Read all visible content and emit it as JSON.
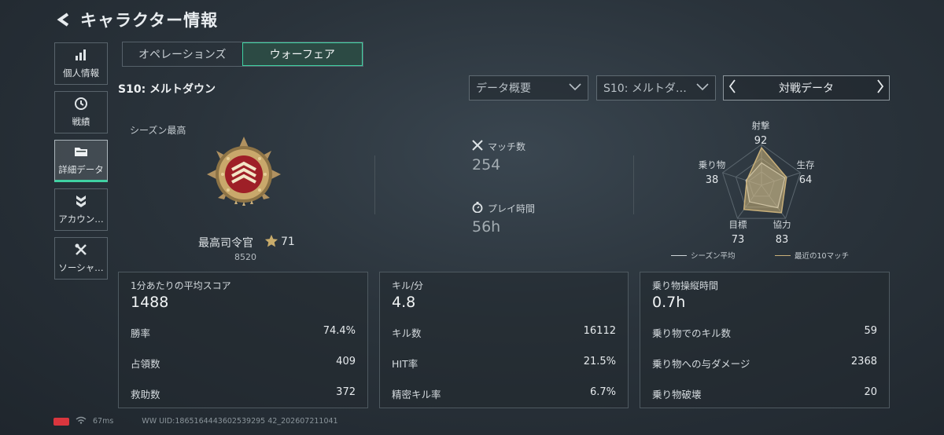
{
  "header": {
    "title": "キャラクター情報"
  },
  "sidenav": [
    {
      "label": "個人情報",
      "icon": "bar-chart-icon"
    },
    {
      "label": "戦績",
      "icon": "history-icon"
    },
    {
      "label": "詳細データ",
      "icon": "folder-icon"
    },
    {
      "label": "アカウン…",
      "icon": "rank-chevron-icon"
    },
    {
      "label": "ソーシャ…",
      "icon": "tools-icon"
    }
  ],
  "tabs": [
    {
      "label": "オペレーションズ"
    },
    {
      "label": "ウォーフェア"
    }
  ],
  "season": {
    "title": "S10: メルトダウン"
  },
  "filters": {
    "overview": "データ概要",
    "season": "S10: メルトダ…",
    "battle": "対戦データ"
  },
  "summary": {
    "label": "シーズン最高",
    "rank_name": "最高司令官",
    "rank_stars": "71",
    "rank_points": "8520",
    "matches_label": "マッチ数",
    "matches_value": "254",
    "playtime_label": "プレイ時間",
    "playtime_value": "56h"
  },
  "radar": {
    "axes": [
      {
        "label": "射撃",
        "value": "92"
      },
      {
        "label": "生存",
        "value": "64"
      },
      {
        "label": "協力",
        "value": "83"
      },
      {
        "label": "目標",
        "value": "73"
      },
      {
        "label": "乗り物",
        "value": "38"
      }
    ],
    "legend_season": "シーズン平均",
    "legend_recent": "最近の10マッチ",
    "colors": {
      "season": "#cfd5d9",
      "recent": "#c9b07a"
    }
  },
  "panels": [
    {
      "title": "1分あたりの平均スコア",
      "big": "1488",
      "rows": [
        {
          "label": "勝率",
          "value": "74.4%"
        },
        {
          "label": "占領数",
          "value": "409"
        },
        {
          "label": "救助数",
          "value": "372"
        }
      ]
    },
    {
      "title": "キル/分",
      "big": "4.8",
      "rows": [
        {
          "label": "キル数",
          "value": "16112"
        },
        {
          "label": "HIT率",
          "value": "21.5%"
        },
        {
          "label": "精密キル率",
          "value": "6.7%"
        }
      ]
    },
    {
      "title": "乗り物操縦時間",
      "big": "0.7h",
      "rows": [
        {
          "label": "乗り物でのキル数",
          "value": "59"
        },
        {
          "label": "乗り物への与ダメージ",
          "value": "2368"
        },
        {
          "label": "乗り物破壊",
          "value": "20"
        }
      ]
    }
  ],
  "footer": {
    "ping": "67ms",
    "uid": "WW UID:1865164443602539295 42_202607211041"
  },
  "colors": {
    "accent": "#3fd1a2",
    "battery": "#d9363e"
  }
}
